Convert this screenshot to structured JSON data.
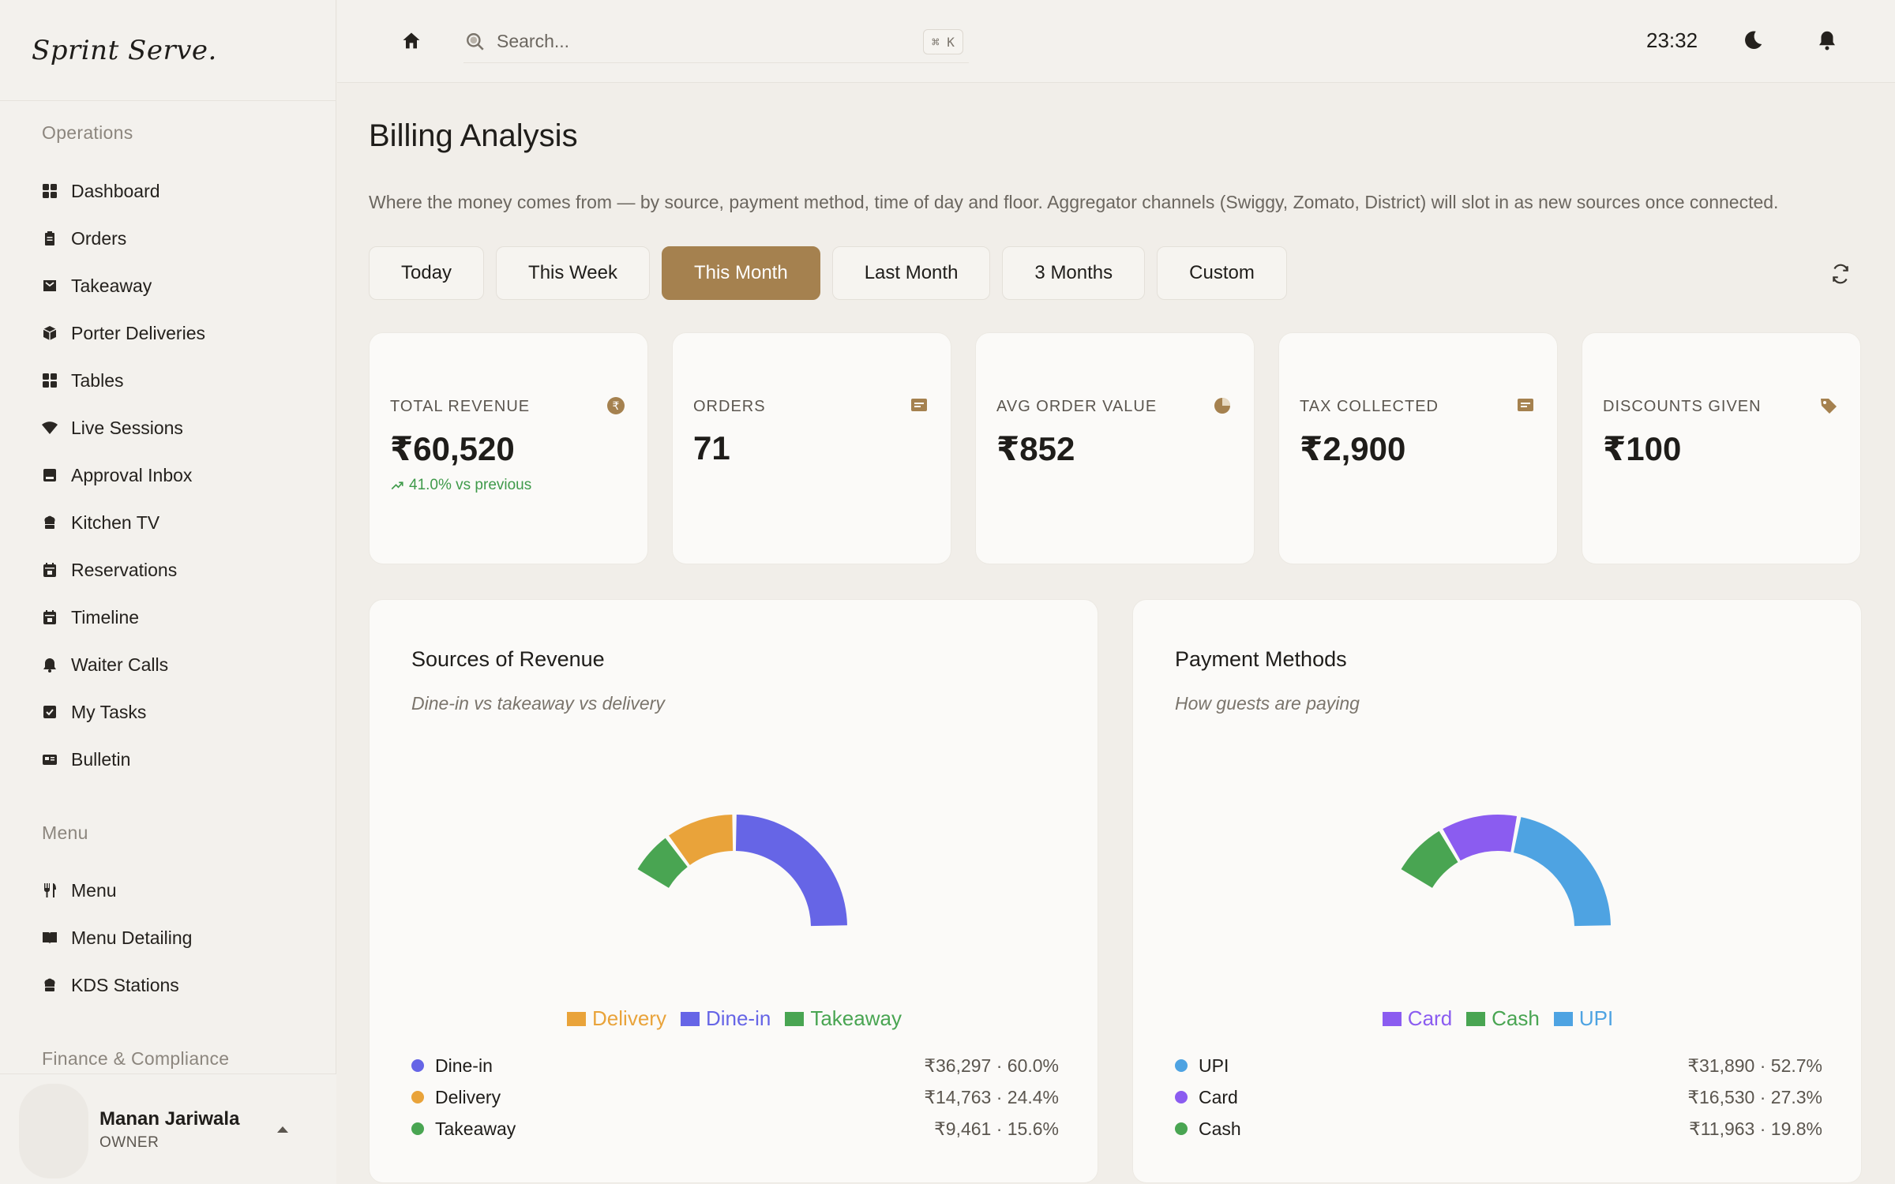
{
  "brand": "Sprint Serve.",
  "sidebar": {
    "sections": [
      {
        "title": "Operations",
        "items": [
          {
            "label": "Dashboard",
            "icon": "grid-icon"
          },
          {
            "label": "Orders",
            "icon": "clipboard-icon"
          },
          {
            "label": "Takeaway",
            "icon": "bag-icon"
          },
          {
            "label": "Porter Deliveries",
            "icon": "box-icon"
          },
          {
            "label": "Tables",
            "icon": "grid-icon"
          },
          {
            "label": "Live Sessions",
            "icon": "wifi-icon"
          },
          {
            "label": "Approval Inbox",
            "icon": "inbox-icon"
          },
          {
            "label": "Kitchen TV",
            "icon": "chef-hat-icon"
          },
          {
            "label": "Reservations",
            "icon": "calendar-icon"
          },
          {
            "label": "Timeline",
            "icon": "calendar-icon"
          },
          {
            "label": "Waiter Calls",
            "icon": "bell-icon"
          },
          {
            "label": "My Tasks",
            "icon": "checkbox-icon"
          },
          {
            "label": "Bulletin",
            "icon": "newspaper-icon"
          }
        ]
      },
      {
        "title": "Menu",
        "items": [
          {
            "label": "Menu",
            "icon": "utensils-icon"
          },
          {
            "label": "Menu Detailing",
            "icon": "book-icon"
          },
          {
            "label": "KDS Stations",
            "icon": "chef-hat-icon"
          }
        ]
      },
      {
        "title": "Finance & Compliance",
        "items": []
      }
    ],
    "user": {
      "name": "Manan Jariwala",
      "role": "OWNER"
    }
  },
  "topbar": {
    "search_placeholder": "Search...",
    "shortcut": "⌘ K",
    "time": "23:32"
  },
  "page": {
    "title": "Billing Analysis",
    "description": "Where the money comes from — by source, payment method, time of day and floor. Aggregator channels (Swiggy, Zomato, District) will slot in as new sources once connected."
  },
  "filters": {
    "options": [
      "Today",
      "This Week",
      "This Month",
      "Last Month",
      "3 Months",
      "Custom"
    ],
    "selected": "This Month"
  },
  "stats": [
    {
      "label": "TOTAL REVENUE",
      "value": "₹60,520",
      "trend": "41.0% vs previous",
      "icon": "rupee-icon"
    },
    {
      "label": "ORDERS",
      "value": "71",
      "trend": "",
      "icon": "receipt-icon"
    },
    {
      "label": "AVG ORDER VALUE",
      "value": "₹852",
      "trend": "",
      "icon": "pie-icon"
    },
    {
      "label": "TAX COLLECTED",
      "value": "₹2,900",
      "trend": "",
      "icon": "receipt-icon"
    },
    {
      "label": "DISCOUNTS GIVEN",
      "value": "₹100",
      "trend": "",
      "icon": "tag-icon"
    }
  ],
  "colors": {
    "accent": "#a5814f",
    "trend_up": "#3f9a4a",
    "dine_in": "#6665e6",
    "delivery": "#e9a33a",
    "takeaway": "#49a552",
    "upi": "#4ea3e2",
    "card": "#8b5cf0",
    "cash": "#49a552"
  },
  "panels": [
    {
      "title": "Sources of Revenue",
      "subtitle": "Dine-in vs takeaway vs delivery",
      "legend": [
        {
          "label": "Delivery",
          "color": "#e9a33a"
        },
        {
          "label": "Dine-in",
          "color": "#6665e6"
        },
        {
          "label": "Takeaway",
          "color": "#49a552"
        }
      ],
      "breakdown": [
        {
          "label": "Dine-in",
          "value": "₹36,297 · 60.0%",
          "color": "#6665e6"
        },
        {
          "label": "Delivery",
          "value": "₹14,763 · 24.4%",
          "color": "#e9a33a"
        },
        {
          "label": "Takeaway",
          "value": "₹9,461 · 15.6%",
          "color": "#49a552"
        }
      ]
    },
    {
      "title": "Payment Methods",
      "subtitle": "How guests are paying",
      "legend": [
        {
          "label": "Card",
          "color": "#8b5cf0"
        },
        {
          "label": "Cash",
          "color": "#49a552"
        },
        {
          "label": "UPI",
          "color": "#4ea3e2"
        }
      ],
      "breakdown": [
        {
          "label": "UPI",
          "value": "₹31,890 · 52.7%",
          "color": "#4ea3e2"
        },
        {
          "label": "Card",
          "value": "₹16,530 · 27.3%",
          "color": "#8b5cf0"
        },
        {
          "label": "Cash",
          "value": "₹11,963 · 19.8%",
          "color": "#49a552"
        }
      ]
    }
  ],
  "chart_data": [
    {
      "type": "pie",
      "categories": [
        "Dine-in",
        "Delivery",
        "Takeaway"
      ],
      "values": [
        36297,
        14763,
        9461
      ],
      "percent": [
        60.0,
        24.4,
        15.6
      ],
      "colors": [
        "#6665e6",
        "#e9a33a",
        "#49a552"
      ],
      "title": "Sources of Revenue"
    },
    {
      "type": "pie",
      "categories": [
        "UPI",
        "Card",
        "Cash"
      ],
      "values": [
        31890,
        16530,
        11963
      ],
      "percent": [
        52.7,
        27.3,
        19.8
      ],
      "colors": [
        "#4ea3e2",
        "#8b5cf0",
        "#49a552"
      ],
      "title": "Payment Methods"
    }
  ]
}
